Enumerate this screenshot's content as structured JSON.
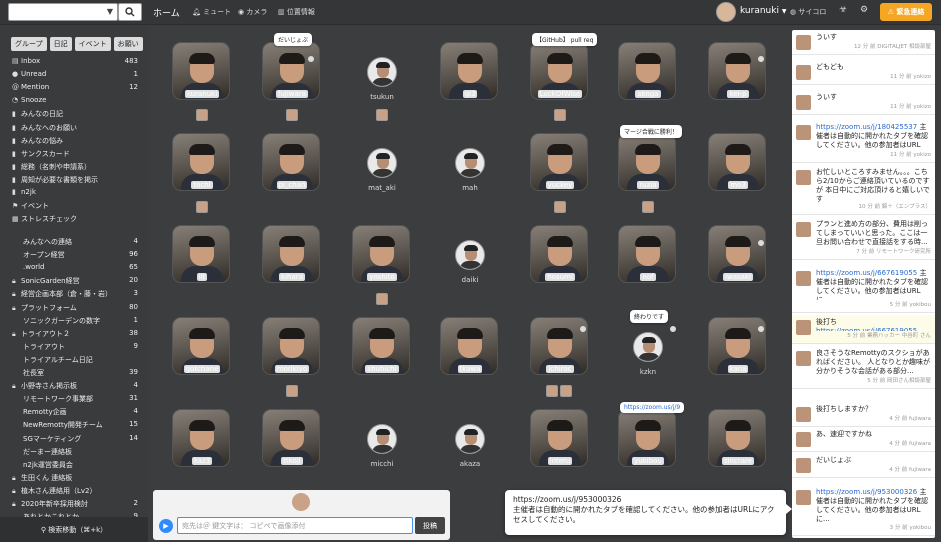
{
  "topbar": {
    "home": "ホーム",
    "mute": "ミュート",
    "camera": "カメラ",
    "location": "位置情報",
    "username": "kuranuki",
    "dice": "サイコロ",
    "emergency": "緊急連絡"
  },
  "sidebar": {
    "tabs": [
      "グループ",
      "日記",
      "イベント",
      "お願い"
    ],
    "items": [
      {
        "label": "Inbox",
        "count": "483"
      },
      {
        "label": "Unread",
        "count": "1"
      },
      {
        "label": "Mention",
        "count": "12"
      },
      {
        "label": "Snooze",
        "count": ""
      },
      {
        "label": "みんなの日記",
        "count": ""
      },
      {
        "label": "みんなへのお願い",
        "count": ""
      },
      {
        "label": "みんなの悩み",
        "count": ""
      },
      {
        "label": "サンクスカード",
        "count": ""
      },
      {
        "label": "総務（名刺や申請系）",
        "count": ""
      },
      {
        "label": "周知が必要な書類を掲示",
        "count": ""
      },
      {
        "label": "n2jk",
        "count": ""
      },
      {
        "label": "イベント",
        "count": ""
      },
      {
        "label": "ストレスチェック",
        "count": ""
      },
      {
        "label": "みんなへの連絡",
        "count": "4"
      },
      {
        "label": "オープン経営",
        "count": "96"
      },
      {
        "label": ".world",
        "count": "65"
      },
      {
        "label": "SonicGarden経営",
        "count": "20"
      },
      {
        "label": "経営企画本部（倉・藤・岩）",
        "count": "3"
      },
      {
        "label": "プラットフォーム",
        "count": "80"
      },
      {
        "label": "ソニックガーデンの数字",
        "count": "1"
      },
      {
        "label": "トライアウト２",
        "count": "38"
      },
      {
        "label": "トライアウト",
        "count": "9"
      },
      {
        "label": "トライアルチーム日記",
        "count": ""
      },
      {
        "label": "社長室",
        "count": "39"
      },
      {
        "label": "小野寺さん掲示板",
        "count": "4"
      },
      {
        "label": "リモートワーク事業部",
        "count": "31"
      },
      {
        "label": "Remotty企画",
        "count": "4"
      },
      {
        "label": "NewRemotty開発チーム",
        "count": "15"
      },
      {
        "label": "SGマーケティング",
        "count": "14"
      },
      {
        "label": "だーまー連絡板",
        "count": ""
      },
      {
        "label": "n2jk運営委員会",
        "count": ""
      },
      {
        "label": "生田くん 連絡板",
        "count": ""
      },
      {
        "label": "植木さん連絡用（Lv2）",
        "count": ""
      },
      {
        "label": "2020年新卒採用検討",
        "count": "2"
      },
      {
        "label": "あれとかこれとか",
        "count": "9"
      }
    ],
    "footer": "検索移動（⌘+k）"
  },
  "people": [
    "kuranuki",
    "fujiwara",
    "tsukun",
    "gi3",
    "LuckOfWise",
    "senga",
    "kei-p",
    "tochi",
    "pi_chan",
    "mat_aki",
    "mah",
    "yuckey",
    "ruzia",
    "mo3",
    "iit",
    "kihara",
    "yoshito",
    "daiki",
    "hosumi",
    "nof",
    "iwasaki",
    "gotchane",
    "morikiyo",
    "shuhichi",
    "tkawa",
    "ichiroc",
    "kzkn",
    "kana",
    "kaz3",
    "ttkoji",
    "micchi",
    "akaza",
    "interu",
    "yukibou",
    "sincrare"
  ],
  "bubbles": {
    "fujiwara": "だいじょぶ",
    "luck": "【GitHub】 pull req",
    "ruzia": "マージ合戦に勝利！",
    "kzkn": "終わりです",
    "yukibou": "https://zoom.us/j/9"
  },
  "compose": {
    "placeholder": "宛先は＠ 鍵文字は： コピペで画像添付",
    "post": "投稿"
  },
  "popup": {
    "url": "https://zoom.us/j/953000326",
    "text": "主催者は自動的に開かれたタブを確認してください。他の参加者はURLにアクセスしてください。"
  },
  "chat": [
    {
      "text": "ういす",
      "link": "",
      "meta": "12 分 前 DIGITALJET 相談部屋"
    },
    {
      "text": "どもども",
      "link": "",
      "meta": "11 分 前 yokizo"
    },
    {
      "text": "ういす",
      "link": "",
      "meta": "11 分 前 yokizo"
    },
    {
      "text": "主催者は自動的に開かれたタブを確認してください。他の参加者はURLに...",
      "link": "https://zoom.us/j/180425537",
      "meta": "11 分 前 yokizo"
    },
    {
      "text": "お忙しいところすみません。。。こちら2/10からご連絡頂いているのですが 本日中にご対応頂けると嬉しいです",
      "link": "",
      "meta": "10 分 前 錦＋（エンプラス）"
    },
    {
      "text": "プランと進め方の部分、費用は削ってしまっていいと思った。ここは一旦お問い合わせで直接話をする時...",
      "link": "",
      "meta": "7 分 前 リモートワーク研究所"
    },
    {
      "text": "主催者は自動的に開かれたタブを確認してください。他の参加者はURLに...",
      "link": "https://zoom.us/j/667619055",
      "meta": "5 分 前 yokibou"
    },
    {
      "text": "後打ち",
      "link": "https://zoom.us/j/667619055",
      "meta": "5 分 前 業務ハッカー 中谷町 さん"
    },
    {
      "text": "良さそうなRemottyのスクショがあればください。 人となりとか趣味が分かりそうな会話がある部分...",
      "link": "",
      "meta": "5 分 前 岡田さん相談部屋"
    },
    {
      "text": "後打ちしますか？",
      "link": "",
      "meta": "4 分 前 fujiwara"
    },
    {
      "text": "あ、速迎ですかね",
      "link": "",
      "meta": "4 分 前 fujiwara"
    },
    {
      "text": "だいじょぶ",
      "link": "",
      "meta": "4 分 前 fujiwara"
    },
    {
      "text": "主催者は自動的に開かれたタブを確認してください。他の参加者はURLに...",
      "link": "https://zoom.us/j/953000326",
      "meta": "3 分 前 yokibou"
    }
  ]
}
